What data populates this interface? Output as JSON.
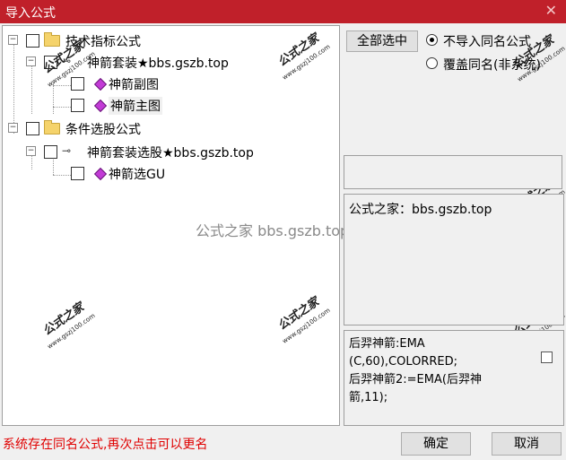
{
  "window": {
    "title": "导入公式"
  },
  "tree": {
    "items": [
      {
        "label": "技术指标公式"
      },
      {
        "label": "神箭套装★bbs.gszb.top"
      },
      {
        "label": "神箭副图"
      },
      {
        "label": "神箭主图"
      },
      {
        "label": "条件选股公式"
      },
      {
        "label": "神箭套装选股★bbs.gszb.top"
      },
      {
        "label": "神箭选GU"
      }
    ]
  },
  "options": {
    "select_all_label": "全部选中",
    "radio_skip_label": "不导入同名公式",
    "radio_overwrite_label": "覆盖同名(非系统)",
    "selected": "不导入同名公式"
  },
  "description": {
    "text": "公式之家：bbs.gszb.top"
  },
  "code": {
    "lines": [
      "后羿神箭:EMA",
      "(C,60),COLORRED;",
      "后羿神箭2:=EMA(后羿神",
      "箭,11);"
    ]
  },
  "watermark": {
    "center": "公式之家 bbs.gszb.top",
    "stamp_big": "公式之家",
    "stamp_small": "www.gszj100.com"
  },
  "status": {
    "message": "系统存在同名公式,再次点击可以更名"
  },
  "buttons": {
    "ok_label": "确定",
    "cancel_label": "取消"
  },
  "colors": {
    "title_bar": "#c0202a",
    "status_text": "#e00000"
  }
}
